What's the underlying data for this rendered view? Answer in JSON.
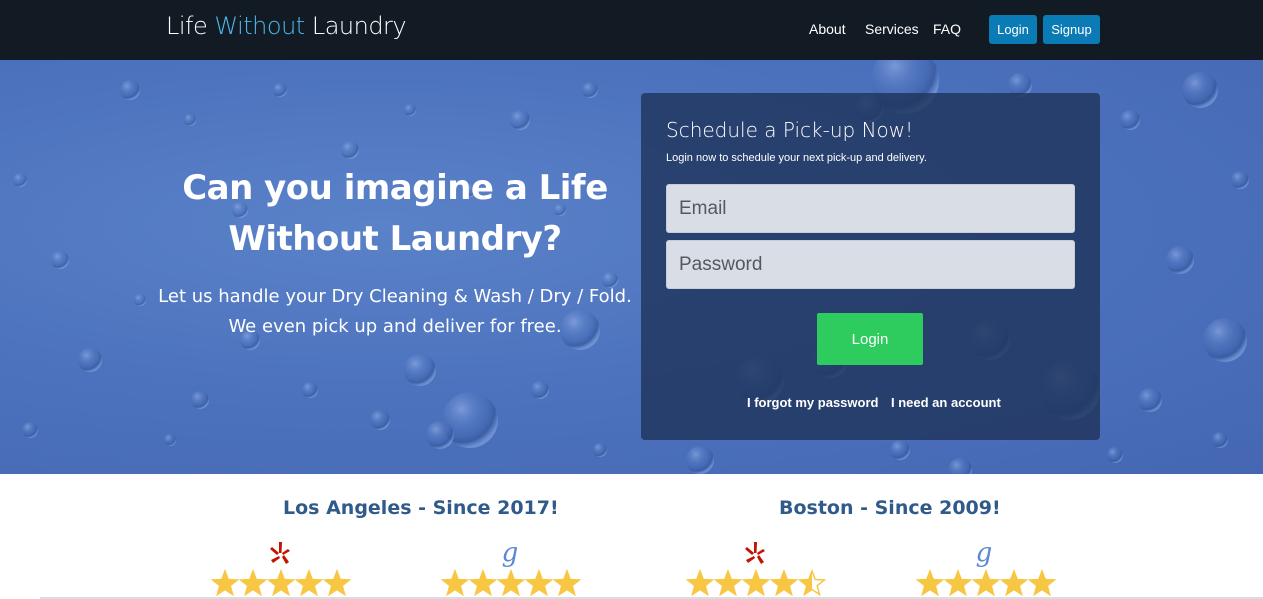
{
  "navbar": {
    "logo": {
      "part1": "Life ",
      "part2": "Without",
      "part3": " Laundry"
    },
    "links": [
      "About",
      "Services",
      "FAQ"
    ],
    "login_label": "Login",
    "signup_label": "Signup"
  },
  "hero": {
    "heading": "Can you imagine a Life Without Laundry?",
    "subheading_line1": "Let us handle your Dry Cleaning & Wash / Dry / Fold.",
    "subheading_line2": "We even pick up and deliver for free."
  },
  "login_panel": {
    "title": "Schedule a Pick-up Now!",
    "subtitle": "Login now to schedule your next pick-up and delivery.",
    "email_placeholder": "Email",
    "email_value": "",
    "password_placeholder": "Password",
    "password_value": "",
    "login_label": "Login",
    "forgot_label": "I forgot my password",
    "account_label": "I need an account"
  },
  "reviews": {
    "cities": [
      {
        "name": "Los Angeles - Since 2017!",
        "sites": [
          {
            "icon": "yelp-icon",
            "rating": 5
          },
          {
            "icon": "google-icon",
            "rating": 5
          }
        ]
      },
      {
        "name": "Boston - Since 2009!",
        "sites": [
          {
            "icon": "yelp-icon",
            "rating": 4.5
          },
          {
            "icon": "google-icon",
            "rating": 5
          }
        ]
      }
    ]
  },
  "colors": {
    "navbar_bg": "#121b23",
    "logo_accent": "#4db6ea",
    "nav_button": "#0a7bb5",
    "hero_bg": "#4d73be",
    "panel_bg": "#20345c",
    "login_button": "#2ecc5f",
    "city_heading": "#2f5a8a",
    "yelp": "#c41200",
    "google": "#5a87d6",
    "star": "#f7c744"
  }
}
